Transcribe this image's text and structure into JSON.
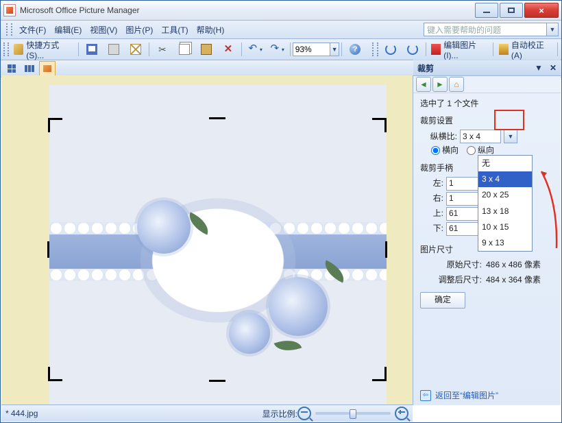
{
  "titlebar": {
    "title": "Microsoft Office Picture Manager"
  },
  "menubar": {
    "file": "文件(F)",
    "edit": "编辑(E)",
    "view": "视图(V)",
    "picture": "图片(P)",
    "tools": "工具(T)",
    "help": "帮助(H)",
    "help_placeholder": "键入需要帮助的问题"
  },
  "toolbar": {
    "shortcut": "快捷方式(S)...",
    "zoom_value": "93%",
    "edit_pictures": "编辑图片(I)...",
    "auto_correct": "自动校正(A)"
  },
  "taskpane": {
    "title": "裁剪",
    "selected": "选中了 1 个文件",
    "crop_settings": "裁剪设置",
    "aspect_label": "纵横比:",
    "aspect_value": "3 x 4",
    "orient_h": "横向",
    "orient_v": "纵向",
    "options": [
      "无",
      "3 x 4",
      "20 x 25",
      "13 x 18",
      "10 x 15",
      "9 x 13"
    ],
    "selected_option_index": 1,
    "handles_hdr": "裁剪手柄",
    "left_l": "左:",
    "right_l": "右:",
    "top_l": "上:",
    "bottom_l": "下:",
    "left_v": "1",
    "right_v": "1",
    "top_v": "61",
    "bottom_v": "61",
    "unit": "像素",
    "size_hdr": "图片尺寸",
    "orig_l": "原始尺寸:",
    "orig_v": "486 x 486 像素",
    "resz_l": "调整后尺寸:",
    "resz_v": "484 x 364 像素",
    "ok": "确定",
    "back": "返回至“编辑图片”"
  },
  "statusbar": {
    "filename": "* 444.jpg",
    "zoom_label": "显示比例:"
  }
}
